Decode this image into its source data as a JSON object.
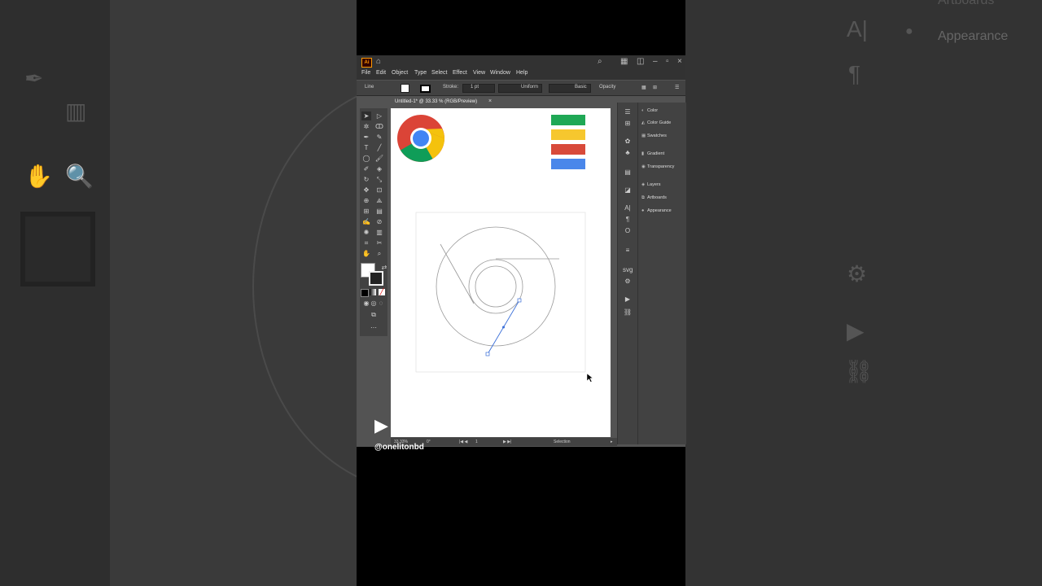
{
  "app": {
    "logo": "Ai",
    "menus": [
      "File",
      "Edit",
      "Object",
      "Type",
      "Select",
      "Effect",
      "View",
      "Window",
      "Help"
    ]
  },
  "control_bar": {
    "selection_type": "Line",
    "stroke_label": "Stroke:",
    "stroke_weight": "1 pt",
    "profile": "Uniform",
    "brush": "Basic",
    "opacity_label": "Opacity"
  },
  "document": {
    "tab_title": "Untitled-1* @ 33.33 % (RGB/Preview)",
    "close_glyph": "×"
  },
  "status": {
    "zoom": "33.33%",
    "rotation": "0°",
    "artboard": "1",
    "tool": "Selection"
  },
  "panels": [
    "Color",
    "Color Guide",
    "Swatches",
    "Gradient",
    "Transparency",
    "Layers",
    "Artboards",
    "Appearance"
  ],
  "blurred_bg": {
    "right_label_1": "Artboards",
    "right_label_2": "Appearance"
  },
  "watermark": "@onelitonbd",
  "colors": {
    "swatch_green": "#1fa855",
    "swatch_yellow": "#f6c72e",
    "swatch_red": "#d84a3a",
    "swatch_blue": "#4a87ea",
    "chrome_red": "#db4437",
    "chrome_yellow": "#f4c20d",
    "chrome_green": "#0f9d58",
    "chrome_blue": "#4285f4"
  }
}
